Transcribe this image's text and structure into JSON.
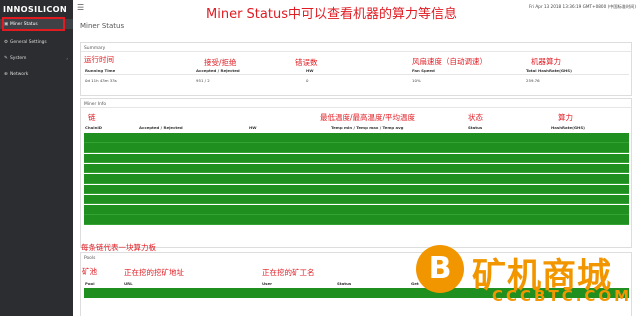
{
  "app": {
    "logo": "INNOSILICON",
    "datetime": "Fri Apr 13 2018 13:36:19 GMT+0800 (中国标准时间)"
  },
  "sidebar": {
    "items": [
      {
        "label": "Miner Status",
        "icon": "dashboard-icon"
      },
      {
        "label": "General Settings",
        "icon": "gear-icon"
      },
      {
        "label": "System",
        "icon": "wrench-icon"
      },
      {
        "label": "Network",
        "icon": "network-icon"
      }
    ]
  },
  "annotations": {
    "top": "Miner Status中可以查看机器的算力等信息",
    "running_time": "运行时间",
    "accepted_rejected": "接受/拒绝",
    "hw_errors": "错误数",
    "fan_speed": "风扇速度（自动调速）",
    "total_hashrate": "机器算力",
    "chain": "链",
    "temps": "最低温度/最高温度/平均温度",
    "status": "状态",
    "hashrate": "算力",
    "per_board": "每条链代表一块算力板",
    "pool": "矿池",
    "pool_url": "正在挖的挖矿地址",
    "worker": "正在挖的矿工名"
  },
  "page": {
    "title": "Miner Status"
  },
  "summary": {
    "title": "Summary",
    "headers": [
      "Running Time",
      "Accepted / Rejected",
      "HW",
      "Fan Speed",
      "Total HashRate(GHS)"
    ],
    "values": [
      "0d 11h 43m 33s",
      "951 / 2",
      "0",
      "10%",
      "259.76"
    ]
  },
  "miner_info": {
    "title": "Miner Info",
    "headers": [
      "ChainID",
      "Accepted / Rejected",
      "HW",
      "Temp min / Temp max / Temp avg",
      "Status",
      "HashRate(GHS)"
    ],
    "rows": [
      [
        "",
        "",
        "",
        "",
        "",
        ""
      ],
      [
        "",
        "",
        "",
        "",
        "",
        ""
      ],
      [
        "",
        "",
        "",
        "",
        "",
        ""
      ],
      [
        "",
        "",
        "",
        "",
        "",
        ""
      ],
      [
        "",
        "",
        "",
        "",
        "",
        ""
      ],
      [
        "",
        "",
        "",
        "",
        "",
        ""
      ],
      [
        "",
        "",
        "",
        "",
        "",
        ""
      ],
      [
        "",
        "",
        "",
        "",
        "",
        ""
      ],
      [
        "",
        "",
        "",
        "",
        "",
        ""
      ]
    ]
  },
  "pools": {
    "title": "Pools",
    "headers": [
      "Pool",
      "URL",
      "User",
      "Status",
      "Get"
    ],
    "rows": [
      [
        "",
        "",
        "",
        "",
        ""
      ]
    ]
  },
  "watermark": {
    "logo": "B",
    "text": "矿机商城",
    "url": "CCCBTC.COM"
  }
}
